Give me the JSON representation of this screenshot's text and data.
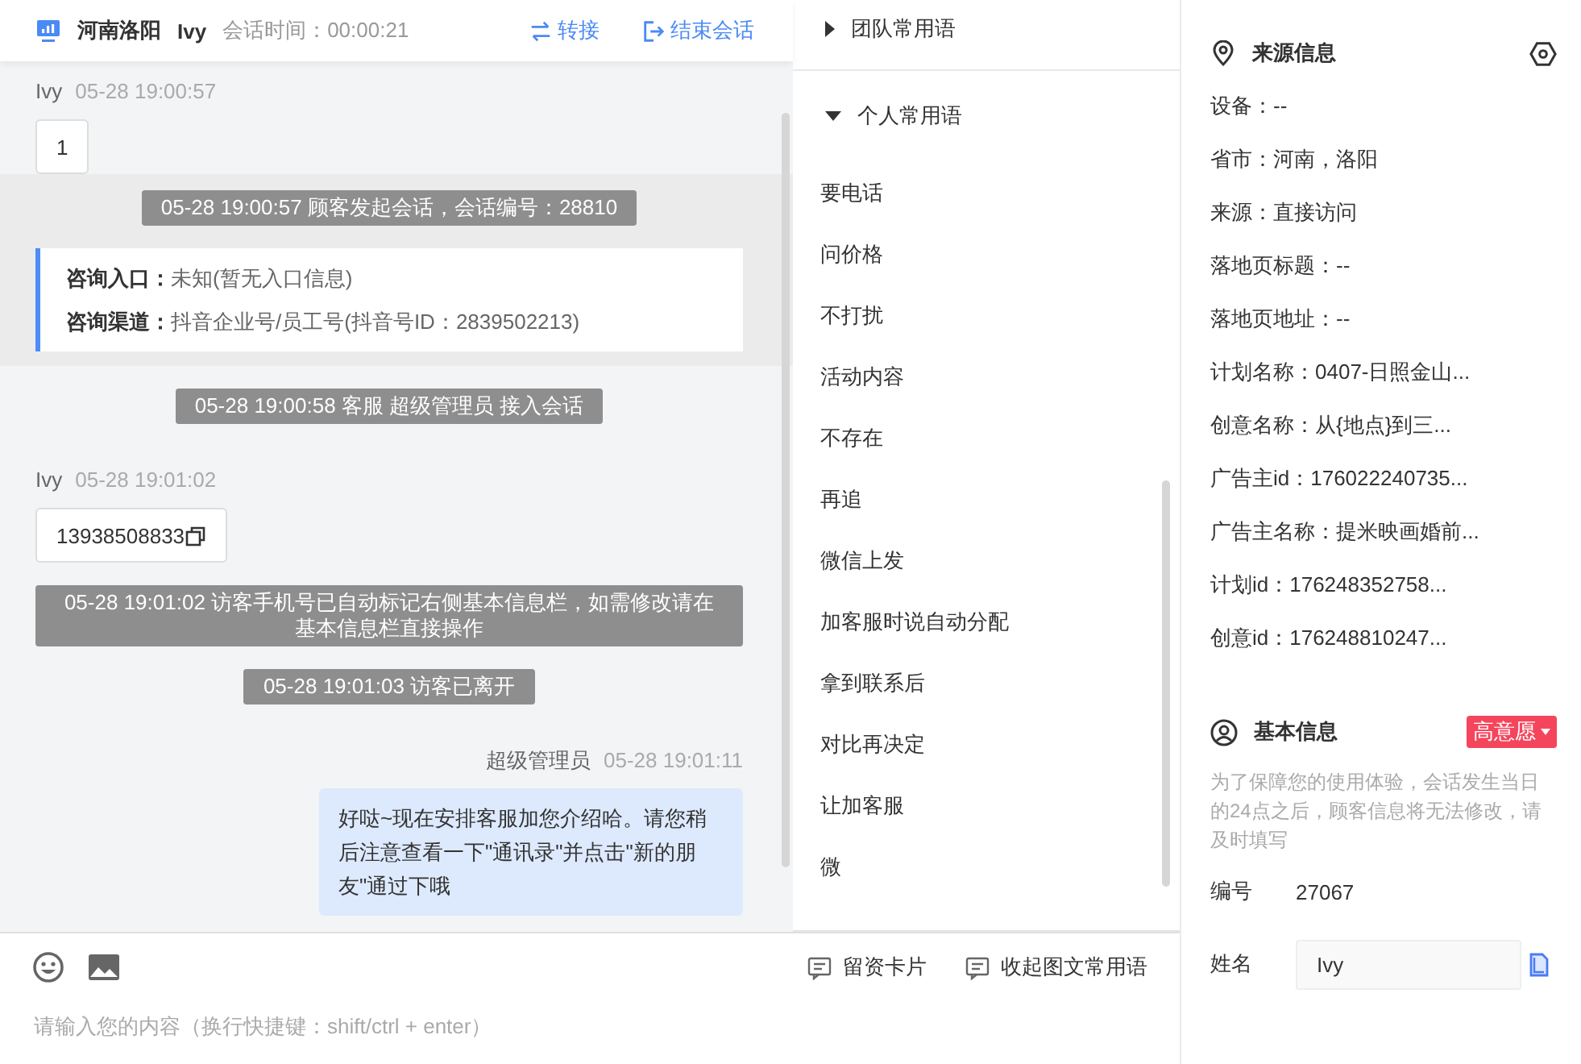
{
  "header": {
    "location": "河南洛阳",
    "visitor": "Ivy",
    "duration": "会话时间：00:00:21",
    "actions": [
      {
        "kind": "transfer",
        "label": "转接"
      },
      {
        "kind": "end",
        "label": "结束会话"
      }
    ]
  },
  "messages": [
    {
      "kind": "visitor",
      "sender": "Ivy",
      "time": "05-28 19:00:57",
      "text": "1",
      "copyable": false,
      "highlighted": false
    },
    {
      "kind": "system",
      "text": "05-28 19:00:57 顾客发起会话，会话编号：28810",
      "highlighted": true
    },
    {
      "kind": "info",
      "highlighted": true,
      "lines": [
        {
          "label": "咨询入口：",
          "value": "未知(暂无入口信息)"
        },
        {
          "label": "咨询渠道：",
          "value": "抖音企业号/员工号(抖音号ID：2839502213)"
        }
      ]
    },
    {
      "kind": "system",
      "text": "05-28 19:00:58 客服 超级管理员 接入会话",
      "highlighted": false
    },
    {
      "kind": "visitor",
      "sender": "Ivy",
      "time": "05-28 19:01:02",
      "text": "13938508833",
      "copyable": true,
      "highlighted": false
    },
    {
      "kind": "system",
      "text": "05-28 19:01:02 访客手机号已自动标记右侧基本信息栏，如需修改请在基本信息栏直接操作",
      "highlighted": false
    },
    {
      "kind": "system",
      "text": "05-28 19:01:03 访客已离开",
      "highlighted": false
    },
    {
      "kind": "agent",
      "sender": "超级管理员",
      "time": "05-28 19:01:11",
      "text": "好哒~现在安排客服加您介绍哈。请您稍后注意查看一下\"通讯录\"并点击\"新的朋友\"通过下哦",
      "highlighted": false
    }
  ],
  "phrases": {
    "groups": [
      {
        "title": "团队常用语",
        "expanded": false
      },
      {
        "title": "个人常用语",
        "expanded": true,
        "items": [
          "要电话",
          "问价格",
          "不打扰",
          "活动内容",
          "不存在",
          "再追",
          "微信上发",
          "加客服时说自动分配",
          "拿到联系后",
          "对比再决定",
          "让加客服",
          "微"
        ]
      }
    ]
  },
  "composer": {
    "actions": [
      "留资卡片",
      "收起图文常用语"
    ],
    "placeholder": "请输入您的内容（换行快捷键：shift/ctrl + enter）"
  },
  "info": {
    "source": {
      "title": "来源信息",
      "rows": [
        "设备：--",
        "省市：河南，洛阳",
        "来源：直接访问",
        "落地页标题：--",
        "落地页地址：--",
        "计划名称：0407-日照金山...",
        "创意名称：从{地点}到三...",
        "广告主id：176022240735...",
        "广告主名称：提米映画婚前...",
        "计划id：176248352758...",
        "创意id：176248810247..."
      ]
    },
    "basic": {
      "title": "基本信息",
      "tag": "高意愿",
      "note": "为了保障您的使用体验，会话发生当日的24点之后，顾客信息将无法修改，请及时填写",
      "fields": [
        {
          "kind": "text",
          "label": "编号",
          "value": "27067"
        },
        {
          "kind": "input",
          "label": "姓名",
          "value": "Ivy"
        }
      ]
    }
  }
}
